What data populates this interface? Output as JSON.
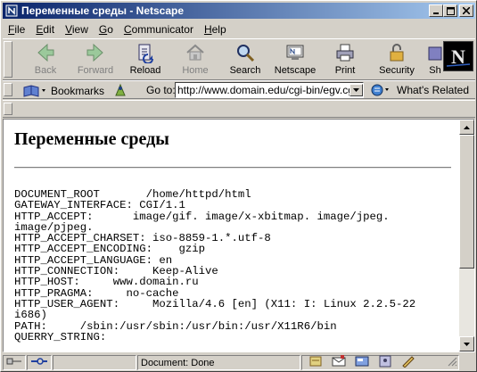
{
  "window": {
    "title": "Переменные среды - Netscape",
    "minimize": "_",
    "maximize": "□",
    "close": "✕"
  },
  "menu": [
    "File",
    "Edit",
    "View",
    "Go",
    "Communicator",
    "Help"
  ],
  "menu_mnemonics": [
    "F",
    "E",
    "V",
    "G",
    "C",
    "H"
  ],
  "toolbar": {
    "buttons": [
      {
        "label": "Back",
        "icon": "back-arrow-icon",
        "enabled": false
      },
      {
        "label": "Forward",
        "icon": "forward-arrow-icon",
        "enabled": false
      },
      {
        "label": "Reload",
        "icon": "reload-icon",
        "enabled": true
      },
      {
        "label": "Home",
        "icon": "home-icon",
        "enabled": false
      },
      {
        "label": "Search",
        "icon": "search-icon",
        "enabled": true
      },
      {
        "label": "Netscape",
        "icon": "netscape-icon",
        "enabled": true
      },
      {
        "label": "Print",
        "icon": "print-icon",
        "enabled": true
      },
      {
        "label": "Security",
        "icon": "lock-icon",
        "enabled": true
      },
      {
        "label": "Sh",
        "icon": "shop-icon",
        "enabled": true
      }
    ],
    "logo_letter": "N"
  },
  "location": {
    "bookmarks_label": "Bookmarks",
    "goto_label": "Go to:",
    "url": "http://www.domain.edu/cgi-bin/egv.cgi",
    "related_label": "What's Related"
  },
  "page": {
    "heading": "Переменные среды",
    "env_text": "DOCUMENT_ROOT       /home/httpd/html\nGATEWAY_INTERFACE: CGI/1.1\nHTTP_ACCEPT:      image/gif. image/x-xbitmap. image/jpeg.\nimage/pjpeg.\nHTTP_ACCEPT_CHARSET: iso-8859-1.*.utf-8\nHTTP_ACCEPT_ENCODING:    gzip\nHTTP_ACCEPT_LANGUAGE: en\nHTTP_CONNECTION:     Keep-Alive\nHTTP_HOST:     www.domain.ru\nHTTP_PRAGMA:     no-cache\nHTTP_USER_AGENT:     Mozilla/4.6 [en] (X11: I: Linux 2.2.5-22\ni686)\nPATH:     /sbin:/usr/sbin:/usr/bin:/usr/X11R6/bin\nQUERRY_STRING:"
  },
  "status": {
    "text": "Document: Done"
  }
}
